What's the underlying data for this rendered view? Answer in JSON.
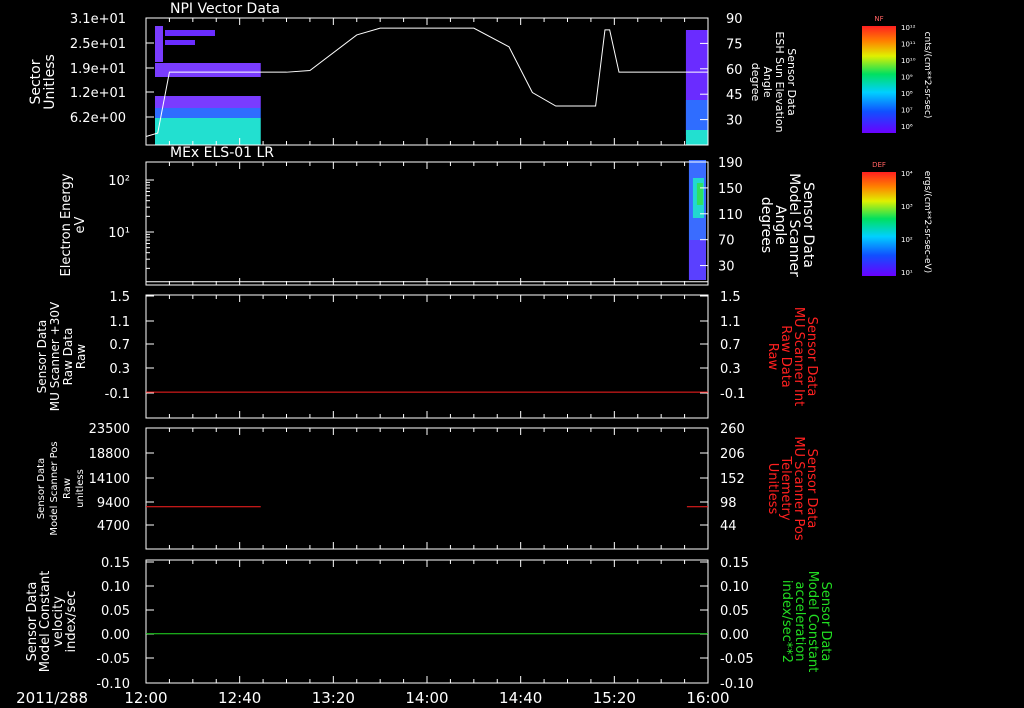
{
  "chart_data": [
    {
      "type": "heatmap",
      "title": "NPI Vector Data",
      "ylabel_left": [
        "Sector",
        "Unitless"
      ],
      "yticks_left": [
        "3.1e+01",
        "2.5e+01",
        "1.9e+01",
        "1.2e+01",
        "6.2e+00"
      ],
      "ylabel_right": [
        "Sensor Data",
        "ESH Sun Elevation",
        "Angle",
        "degree"
      ],
      "yticks_right": [
        "90",
        "75",
        "60",
        "45",
        "30"
      ],
      "right_ylim": [
        15,
        90
      ],
      "line_color": "#ffffff",
      "line_series": {
        "x": [
          "12:00",
          "12:05",
          "12:10",
          "12:30",
          "13:00",
          "13:10",
          "13:30",
          "13:40",
          "14:00",
          "14:20",
          "14:35",
          "14:45",
          "14:55",
          "15:05",
          "15:12",
          "15:16",
          "15:18",
          "15:22",
          "16:00"
        ],
        "y": [
          20,
          22,
          58,
          58,
          58,
          59,
          80,
          84,
          84,
          84,
          73,
          46,
          38,
          38,
          38,
          83,
          83,
          58,
          58
        ]
      },
      "colorbar": {
        "label": "NF",
        "unit": "cnts/(cm**2-sr-sec)",
        "ticks": [
          "10¹²",
          "10¹¹",
          "10¹⁰",
          "10⁹",
          "10⁸",
          "10⁷",
          "10⁶"
        ]
      }
    },
    {
      "type": "heatmap",
      "title": "MEx ELS-01 LR",
      "ylabel_left": [
        "Electron Energy",
        "eV"
      ],
      "yticks_left": [
        "10²",
        "10¹"
      ],
      "ylabel_right": [
        "Sensor Data",
        "Model Scanner",
        "Angle",
        "degrees"
      ],
      "yticks_right": [
        "190",
        "150",
        "110",
        "70",
        "30"
      ],
      "right_ylim": [
        0,
        190
      ],
      "line_color": "#ffffff",
      "line_series": {
        "x": [
          "12:00",
          "16:00"
        ],
        "y": [
          5,
          5
        ]
      },
      "colorbar": {
        "label": "DEF",
        "unit": "ergs/(cm**2-sr-sec-eV)",
        "ticks": [
          "10⁴",
          "10³",
          "10²",
          "10¹"
        ]
      }
    },
    {
      "type": "line",
      "ylabel_left": [
        "Sensor Data",
        "MU Scanner +30V",
        "Raw Data",
        "Raw"
      ],
      "yticks_left": [
        "1.5",
        "1.1",
        "0.7",
        "0.3",
        "-0.1"
      ],
      "ylabel_right": [
        "Sensor Data",
        "MU Scanner Int",
        "Raw Data",
        "Raw"
      ],
      "yticks_right": [
        "1.5",
        "1.1",
        "0.7",
        "0.3",
        "-0.1"
      ],
      "ylim": [
        -0.4,
        1.5
      ],
      "line_color": "#ff2020",
      "label_color": "#ff2020",
      "series": [
        {
          "x": [
            "12:00",
            "16:00"
          ],
          "y": [
            0.0,
            0.0
          ]
        }
      ]
    },
    {
      "type": "line",
      "ylabel_left": [
        "Sensor Data",
        "Model Scanner Pos",
        "Raw",
        "unitless"
      ],
      "yticks_left": [
        "23500",
        "18800",
        "14100",
        "9400",
        "4700"
      ],
      "ylabel_right": [
        "Sensor Data",
        "MU Scanner Pos",
        "Telemetry",
        "Unitless"
      ],
      "yticks_right": [
        "260",
        "206",
        "152",
        "98",
        "44"
      ],
      "ylim": [
        0,
        23500
      ],
      "line_color": "#ff2020",
      "label_color": "#ff2020",
      "series": [
        {
          "x": [
            "12:00",
            "12:49"
          ],
          "y": [
            8200,
            8200
          ]
        },
        {
          "x": [
            "15:51",
            "16:00"
          ],
          "y": [
            8200,
            8200
          ]
        }
      ]
    },
    {
      "type": "line",
      "ylabel_left": [
        "Sensor Data",
        "Model Constant",
        "velocity",
        "index/sec"
      ],
      "yticks_left": [
        "0.15",
        "0.10",
        "0.05",
        "0.00",
        "-0.05",
        "-0.10"
      ],
      "ylabel_right": [
        "Sensor Data",
        "Model Constant",
        "acceleration",
        "index/sec**2"
      ],
      "yticks_right": [
        "0.15",
        "0.10",
        "0.05",
        "0.00",
        "-0.05",
        "-0.10"
      ],
      "ylim": [
        -0.1,
        0.15
      ],
      "line_color": "#22dd22",
      "label_color": "#22dd22",
      "series": [
        {
          "x": [
            "12:00",
            "16:00"
          ],
          "y": [
            0.0,
            0.0
          ]
        }
      ]
    }
  ],
  "x_axis": {
    "date_label": "2011/288",
    "ticks": [
      "12:00",
      "12:40",
      "13:20",
      "14:00",
      "14:40",
      "15:20",
      "16:00"
    ],
    "xlim": [
      "12:00",
      "16:00"
    ]
  }
}
